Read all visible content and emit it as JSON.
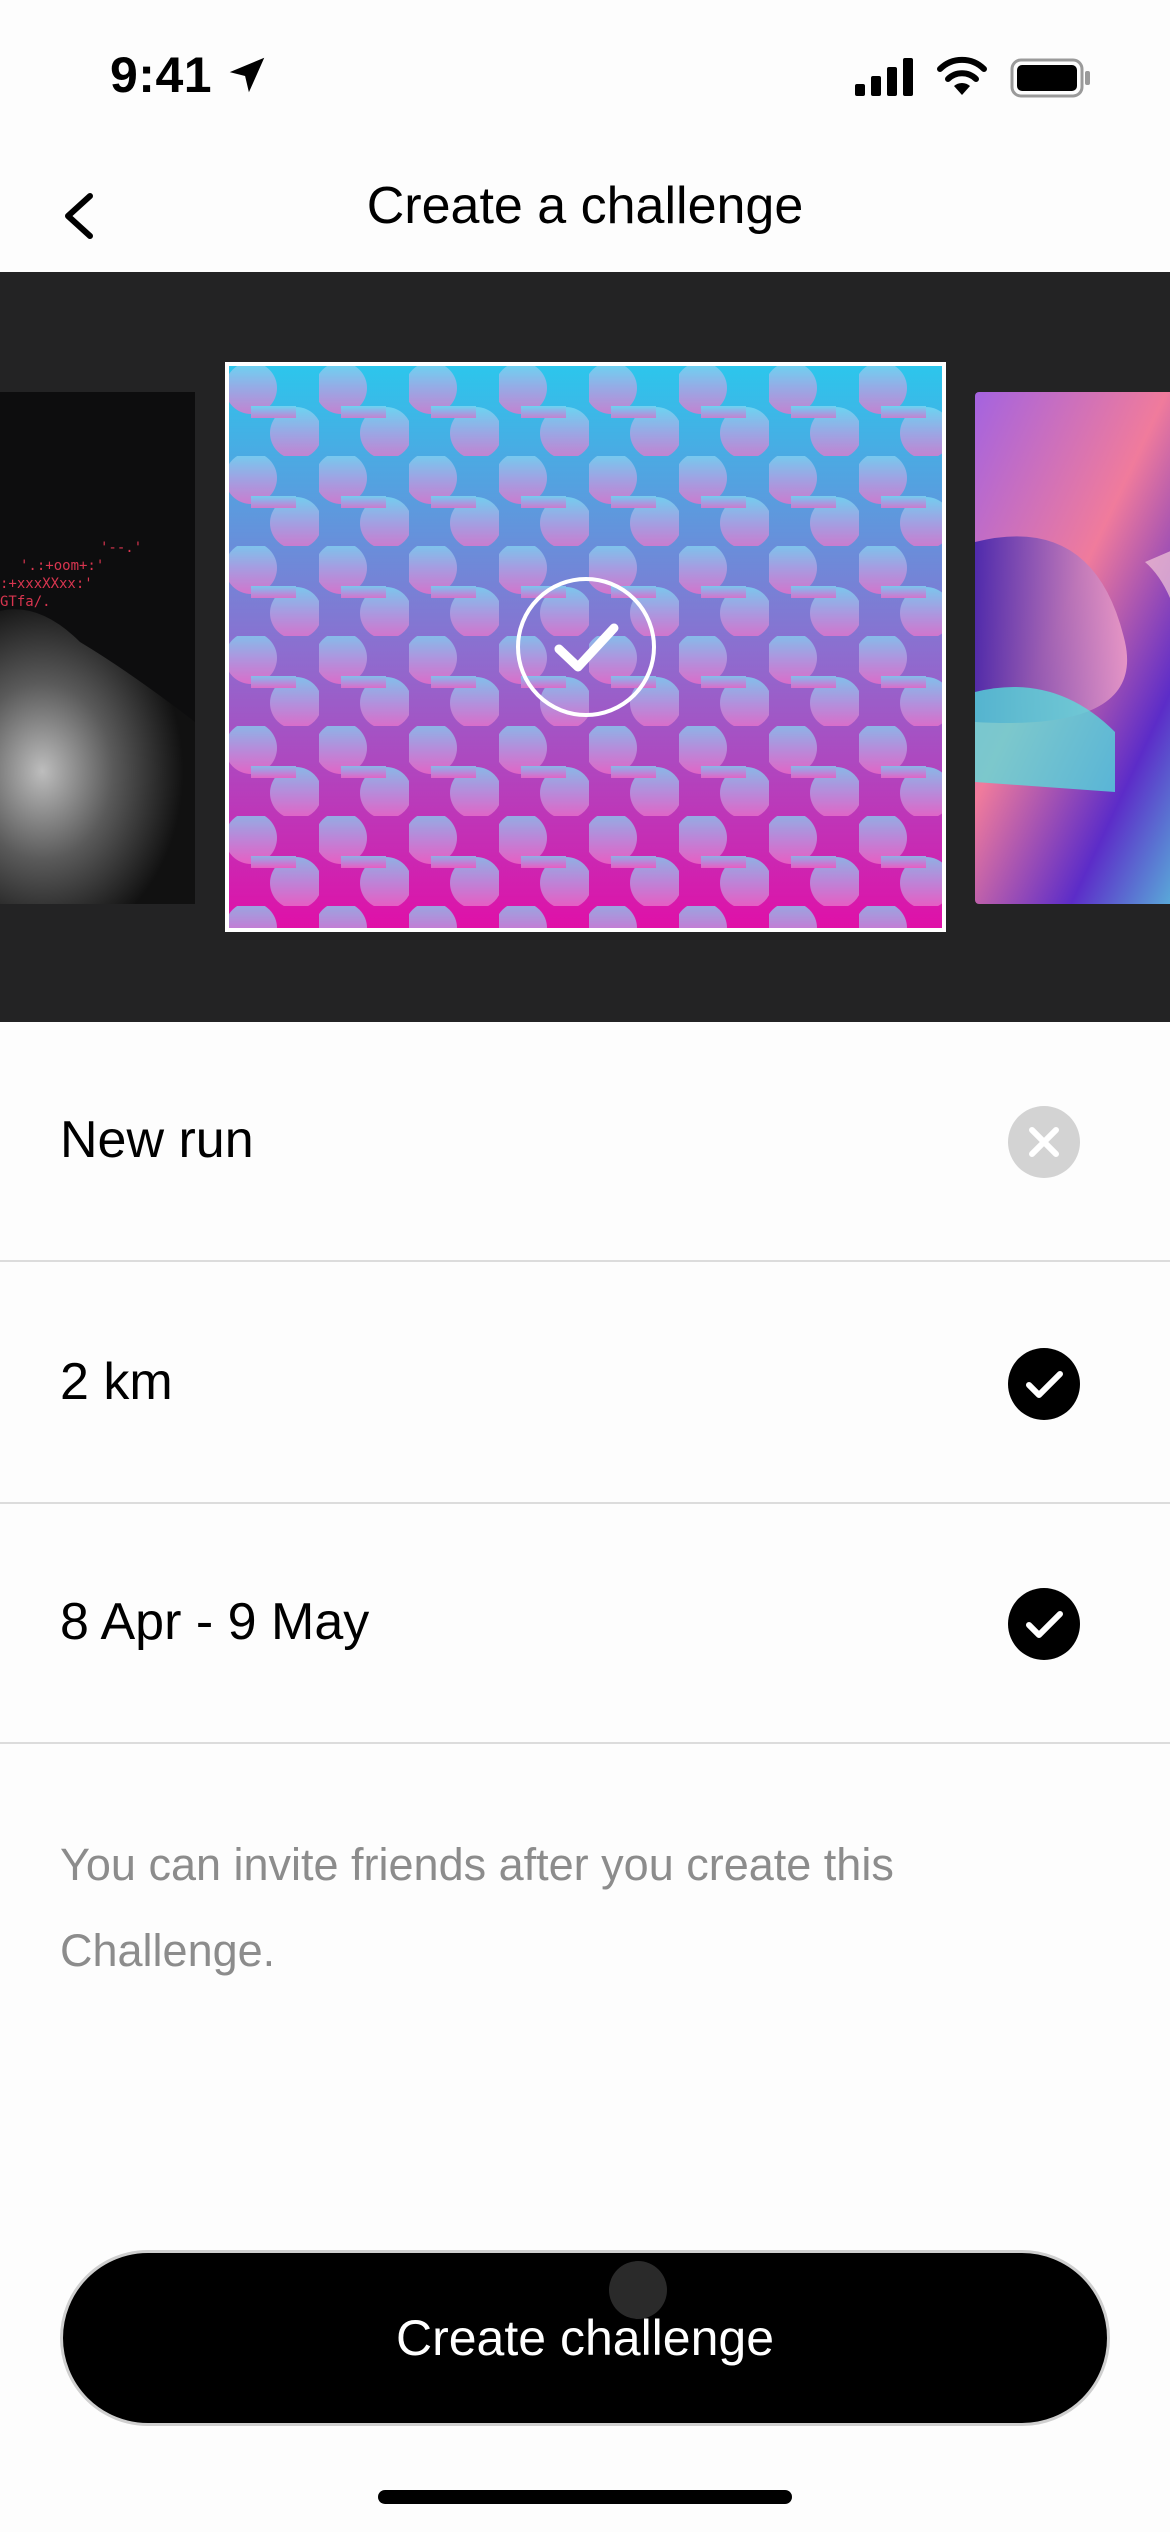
{
  "status_bar": {
    "time": "9:41"
  },
  "nav": {
    "title": "Create a challenge"
  },
  "fields": [
    {
      "label": "New run",
      "state": "clear"
    },
    {
      "label": "2 km",
      "state": "checked"
    },
    {
      "label": "8 Apr - 9 May",
      "state": "checked"
    }
  ],
  "info_text": "You can invite friends after you create this Challenge.",
  "cta": {
    "label": "Create challenge"
  },
  "colors": {
    "accent": "#000000",
    "clear_icon": "#d3d3d3",
    "muted_text": "#8c8c8c",
    "carousel_bg": "#232324"
  }
}
